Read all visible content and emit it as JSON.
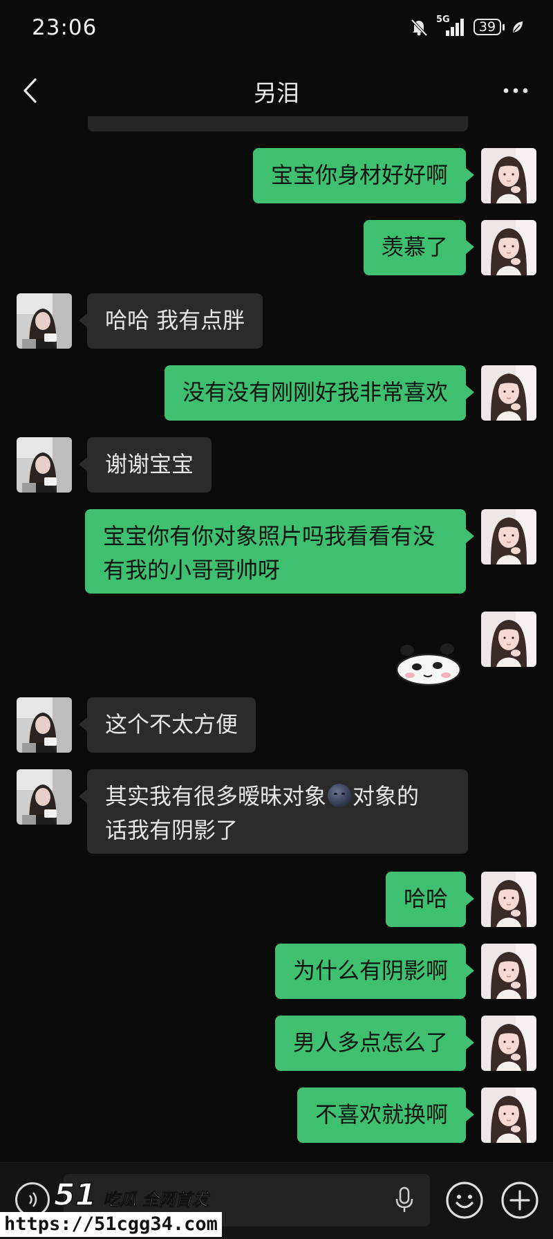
{
  "status_bar": {
    "time": "23:06",
    "signal_label": "5G",
    "battery": "39"
  },
  "header": {
    "title": "另泪"
  },
  "messages": [
    {
      "side": "out",
      "text": "宝宝你身材好好啊"
    },
    {
      "side": "out",
      "text": "羡慕了"
    },
    {
      "side": "in",
      "text": "哈哈 我有点胖"
    },
    {
      "side": "out",
      "text": "没有没有刚刚好我非常喜欢"
    },
    {
      "side": "in",
      "text": "谢谢宝宝"
    },
    {
      "side": "out",
      "line1": "宝宝你有你对象照片吗我看看有没",
      "line2": "有我的小哥哥帅呀"
    },
    {
      "side": "out",
      "type": "sticker",
      "sticker": "panda-sticker"
    },
    {
      "side": "in",
      "text": "这个不太方便"
    },
    {
      "side": "in",
      "part1": "其实我有很多暧昧对象",
      "emoji": "dark-face-emoji",
      "part2": "对象的",
      "line2": "话我有阴影了"
    },
    {
      "side": "out",
      "text": "哈哈"
    },
    {
      "side": "out",
      "text": "为什么有阴影啊"
    },
    {
      "side": "out",
      "text": "男人多点怎么了"
    },
    {
      "side": "out",
      "text": "不喜欢就换啊"
    }
  ],
  "input_bar": {
    "icons": [
      "voice-icon",
      "mic-icon",
      "emoji-icon",
      "plus-icon"
    ]
  },
  "watermark": {
    "logo_number": "51",
    "logo_text": "吃瓜 全网首发",
    "url": "https://51cgg34.com"
  },
  "colors": {
    "background": "#0b0b0b",
    "outgoing_bubble": "#3ec070",
    "incoming_bubble": "#2b2b2b"
  }
}
